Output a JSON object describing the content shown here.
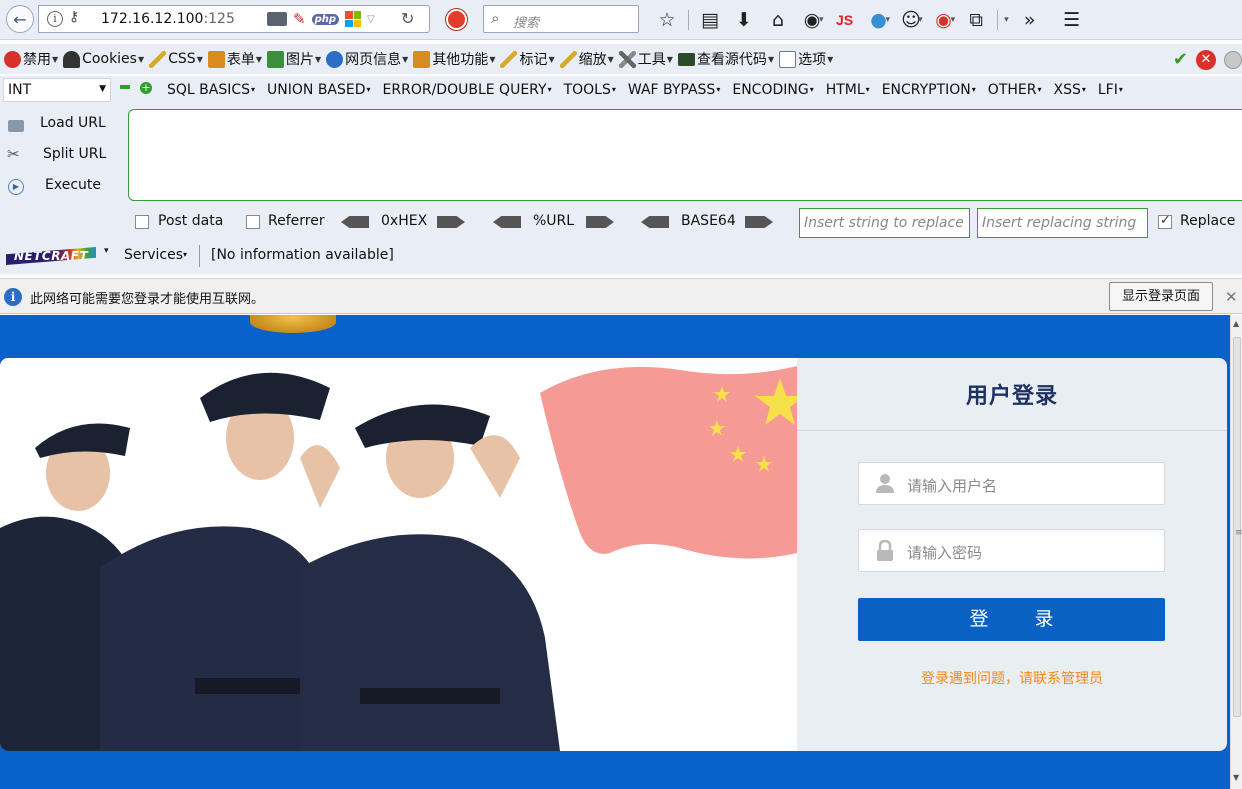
{
  "navbar": {
    "url_host": "172.16.12.100",
    "url_port": ":125",
    "search_placeholder": "搜索",
    "js_label": "JS"
  },
  "bookmarks": [
    {
      "label": "禁用",
      "icon": "disable-icon",
      "color": "#d8312a"
    },
    {
      "label": "Cookies",
      "icon": "cookie-person-icon",
      "color": "#333333"
    },
    {
      "label": "CSS",
      "icon": "css-pencil-icon",
      "color": "#d7a82a"
    },
    {
      "label": "表单",
      "icon": "form-icon",
      "color": "#d98b1f"
    },
    {
      "label": "图片",
      "icon": "image-icon",
      "color": "#3a8f3a"
    },
    {
      "label": "网页信息",
      "icon": "info-icon",
      "color": "#2a6ec8"
    },
    {
      "label": "其他功能",
      "icon": "other-icon",
      "color": "#d98b1f"
    },
    {
      "label": "标记",
      "icon": "highlight-icon",
      "color": "#d7a82a"
    },
    {
      "label": "缩放",
      "icon": "resize-icon",
      "color": "#d7a82a"
    },
    {
      "label": "工具",
      "icon": "tools-icon",
      "color": "#555555"
    },
    {
      "label": "查看源代码",
      "icon": "source-icon",
      "color": "#2a4a2a"
    },
    {
      "label": "选项",
      "icon": "options-icon",
      "color": "#777777"
    }
  ],
  "hackbar": {
    "select_value": "INT",
    "menu_items": [
      "SQL BASICS",
      "UNION BASED",
      "ERROR/DOUBLE QUERY",
      "TOOLS",
      "WAF BYPASS",
      "ENCODING",
      "HTML",
      "ENCRYPTION",
      "OTHER",
      "XSS",
      "LFI"
    ],
    "load_url": "Load URL",
    "split_url": "Split URL",
    "execute": "Execute",
    "post_data": "Post data",
    "referrer": "Referrer",
    "hex": "0xHEX",
    "url_enc": "%URL",
    "base64": "BASE64",
    "insert_replace_placeholder": "Insert string to replace",
    "insert_replacing_placeholder": "Insert replacing string",
    "replace_label": "Replace",
    "services": "Services",
    "netcraft_logo": "NETCRAFT",
    "no_info": "[No information available]"
  },
  "notification": {
    "text": "此网络可能需要您登录才能使用互联网。",
    "button": "显示登录页面"
  },
  "login": {
    "title": "用户登录",
    "username_placeholder": "请输入用户名",
    "password_placeholder": "请输入密码",
    "submit": "登 录",
    "help": "登录遇到问题，请联系管理员"
  },
  "colors": {
    "page_bg": "#0862c9",
    "login_button": "#0a61c4",
    "help_text": "#f08a1a",
    "title": "#1e3262"
  }
}
